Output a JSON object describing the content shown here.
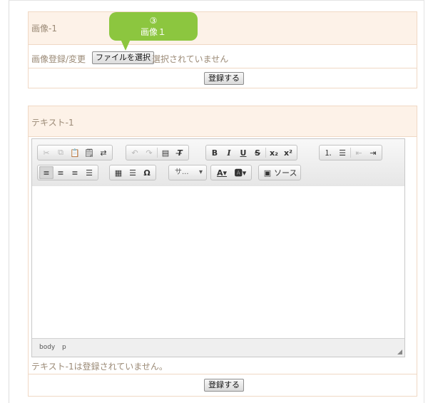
{
  "image_section": {
    "title": "画像-1",
    "register_label": "画像登録/変更",
    "file_button": "ファイルを選択",
    "file_status": "選択されていません",
    "submit_button": "登録する"
  },
  "callout": {
    "number": "③",
    "label": "画像１"
  },
  "text_section": {
    "title": "テキスト-1",
    "status": "テキスト-1は登録されていません。",
    "submit_button": "登録する"
  },
  "editor": {
    "format_combo": "サ...",
    "source_button": "ソース",
    "path": [
      "body",
      "p"
    ],
    "toolbar_icons": {
      "row1": [
        "cut-icon",
        "copy-icon",
        "paste-icon",
        "paste-text-icon",
        "paste-word-icon",
        "undo-icon",
        "redo-icon",
        "find-icon",
        "remove-format-icon",
        "bold-icon",
        "italic-icon",
        "underline-icon",
        "strike-icon",
        "subscript-icon",
        "superscript-icon",
        "numbered-list-icon",
        "bullet-list-icon",
        "outdent-icon",
        "indent-icon"
      ],
      "row2": [
        "align-left-icon",
        "align-center-icon",
        "align-right-icon",
        "justify-icon",
        "table-icon",
        "horizontal-rule-icon",
        "special-char-icon",
        "text-color-icon",
        "bg-color-icon",
        "source-icon"
      ]
    }
  },
  "colors": {
    "accent": "#8cc63f",
    "section_header": "#fdf2e8",
    "section_border": "#f0d8c4"
  }
}
